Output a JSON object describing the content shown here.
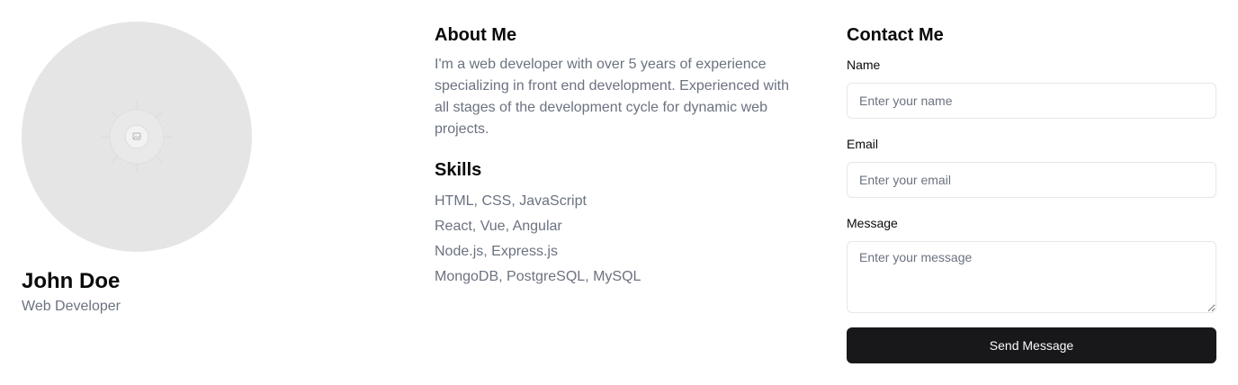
{
  "profile": {
    "avatar_icon": "image-placeholder-icon",
    "name": "John Doe",
    "role": "Web Developer"
  },
  "about": {
    "title": "About Me",
    "text": "I'm a web developer with over 5 years of experience specializing in front end development. Experienced with all stages of the development cycle for dynamic web projects."
  },
  "skills": {
    "title": "Skills",
    "items": [
      "HTML, CSS, JavaScript",
      "React, Vue, Angular",
      "Node.js, Express.js",
      "MongoDB, PostgreSQL, MySQL"
    ]
  },
  "contact": {
    "title": "Contact Me",
    "name_label": "Name",
    "name_placeholder": "Enter your name",
    "email_label": "Email",
    "email_placeholder": "Enter your email",
    "message_label": "Message",
    "message_placeholder": "Enter your message",
    "submit_label": "Send Message"
  },
  "colors": {
    "avatar_bg": "#e5e5e5",
    "muted_text": "#6b7280",
    "button_bg": "#18181b",
    "button_text": "#fafafa",
    "border": "#e5e7eb"
  }
}
